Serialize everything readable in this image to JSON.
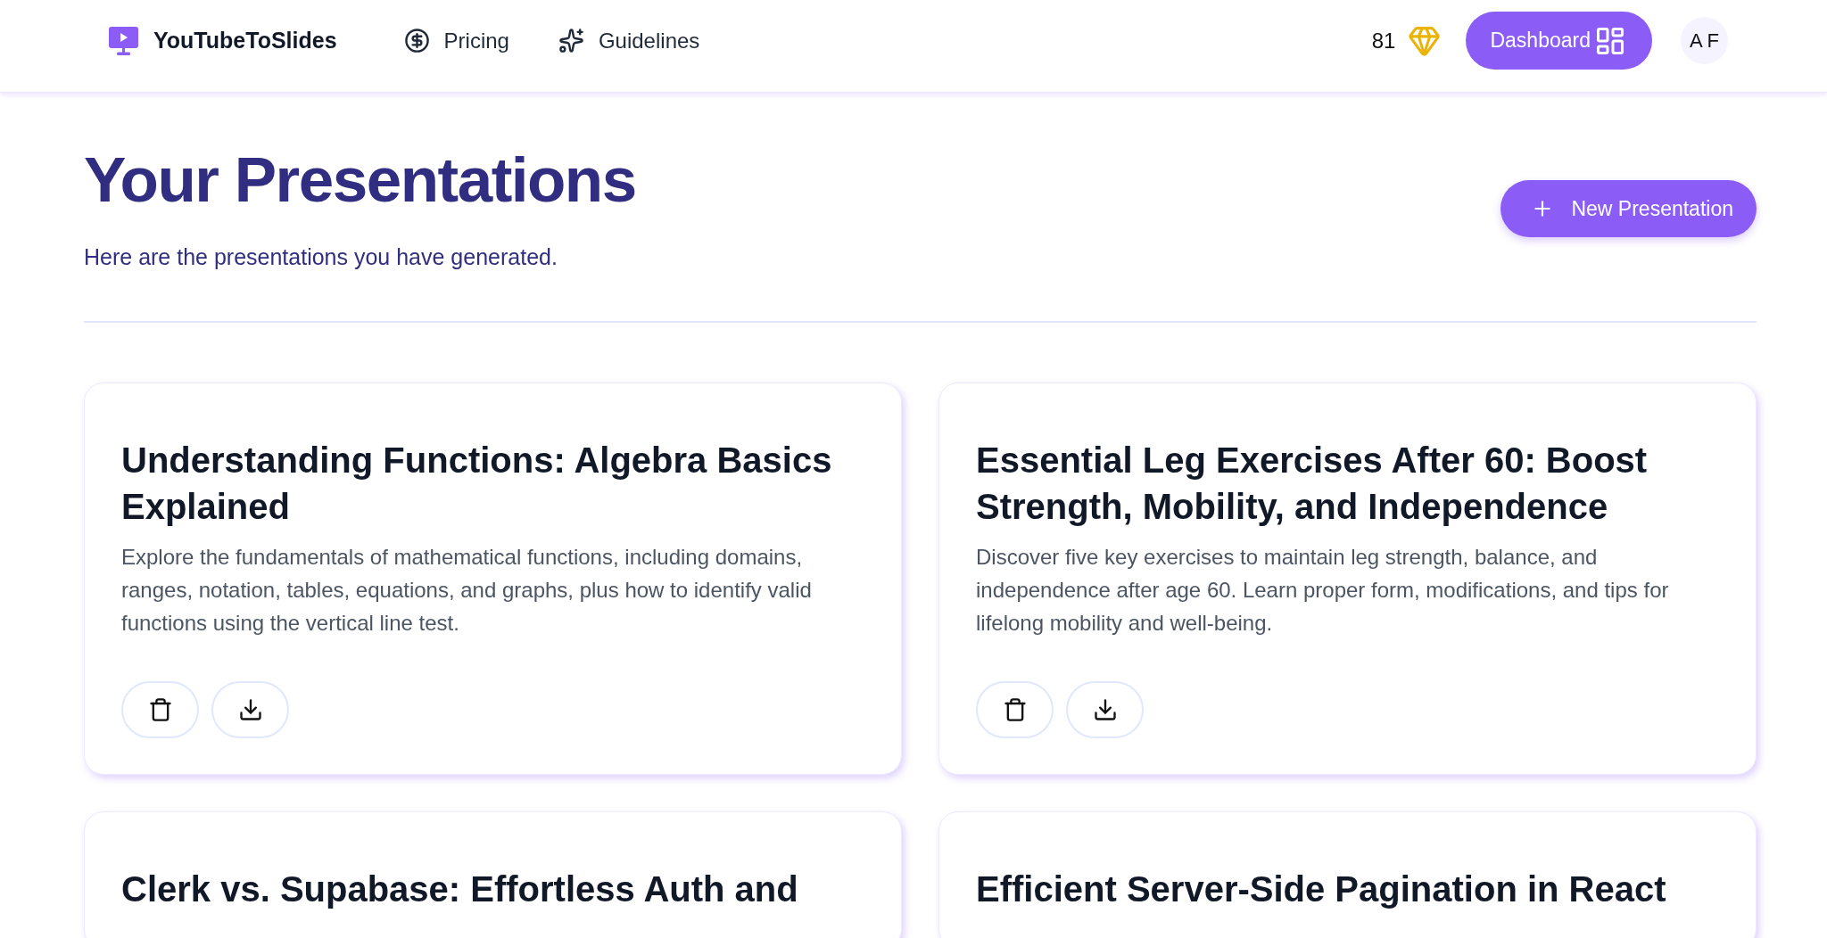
{
  "header": {
    "logo": "YouTubeToSlides",
    "nav": [
      {
        "label": "Pricing"
      },
      {
        "label": "Guidelines"
      }
    ],
    "credits": "81",
    "dashboard_button": "Dashboard",
    "avatar_initials": "A F"
  },
  "page": {
    "title": "Your Presentations",
    "subtitle": "Here are the presentations you have generated.",
    "new_button": "New Presentation"
  },
  "presentations": [
    {
      "title": "Understanding Functions: Algebra Basics Explained",
      "description": "Explore the fundamentals of mathematical functions, including domains, ranges, notation, tables, equations, and graphs, plus how to identify valid functions using the vertical line test."
    },
    {
      "title": "Essential Leg Exercises After 60: Boost Strength, Mobility, and Independence",
      "description": "Discover five key exercises to maintain leg strength, balance, and independence after age 60. Learn proper form, modifications, and tips for lifelong mobility and well-being."
    },
    {
      "title": "Clerk vs. Supabase: Effortless Auth and"
    },
    {
      "title": "Efficient Server-Side Pagination in React"
    }
  ]
}
